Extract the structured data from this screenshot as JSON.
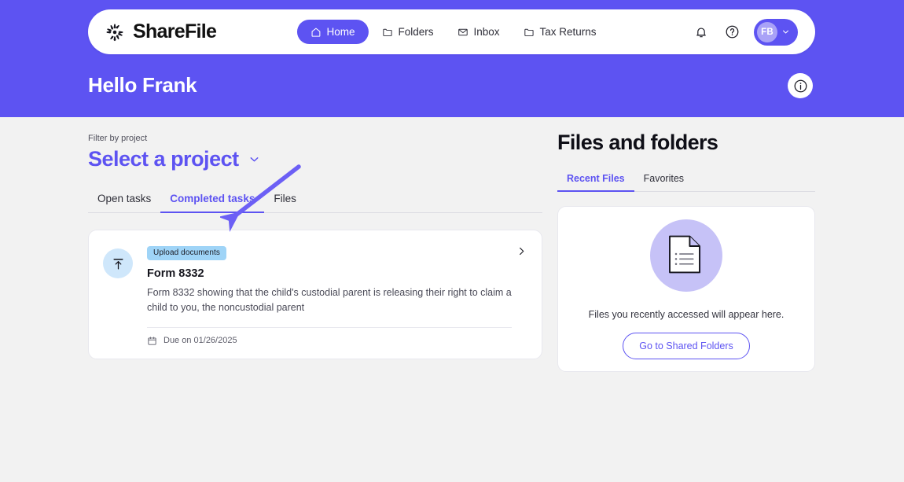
{
  "brand": {
    "name": "ShareFile",
    "logo_icon": "sharefile-burst-logo"
  },
  "topnav": {
    "items": [
      {
        "label": "Home",
        "icon": "home-icon",
        "active": true
      },
      {
        "label": "Folders",
        "icon": "folder-icon",
        "active": false
      },
      {
        "label": "Inbox",
        "icon": "mail-icon",
        "active": false
      },
      {
        "label": "Tax Returns",
        "icon": "folder-icon",
        "active": false
      }
    ],
    "notifications_icon": "bell-icon",
    "help_icon": "question-circle-icon",
    "avatar_initials": "FB",
    "avatar_chevron_icon": "chevron-down-icon"
  },
  "hero": {
    "greeting": "Hello Frank",
    "info_icon": "info-circle-icon"
  },
  "left": {
    "filter_label": "Filter by project",
    "project_selected": "Select a project",
    "project_chevron_icon": "chevron-down-icon",
    "tabs": [
      {
        "label": "Open tasks",
        "active": false
      },
      {
        "label": "Completed tasks",
        "active": true
      },
      {
        "label": "Files",
        "active": false
      }
    ],
    "task": {
      "icon": "upload-icon",
      "badge": "Upload documents",
      "title": "Form 8332",
      "description": "Form 8332 showing that the child's custodial parent is releasing their right to claim a child to you, the noncustodial parent",
      "due_icon": "calendar-icon",
      "due_text": "Due on 01/26/2025",
      "chevron_icon": "chevron-right-icon"
    }
  },
  "right": {
    "title": "Files and folders",
    "tabs": [
      {
        "label": "Recent Files",
        "active": true
      },
      {
        "label": "Favorites",
        "active": false
      }
    ],
    "empty": {
      "illustration_icon": "document-icon",
      "message": "Files you recently accessed will appear here.",
      "button_label": "Go to Shared Folders"
    }
  },
  "annotation": {
    "type": "arrow",
    "points_to": "Completed tasks tab",
    "color": "#6c5ff5"
  },
  "colors": {
    "brand_purple": "#5d53f2",
    "hero_purple": "#5d53f2",
    "page_background": "#f2f2f2",
    "badge_blue": "#9fd4f7",
    "task_icon_blue": "#cfe7fb",
    "illustration_lavender": "#c6c2f7"
  }
}
